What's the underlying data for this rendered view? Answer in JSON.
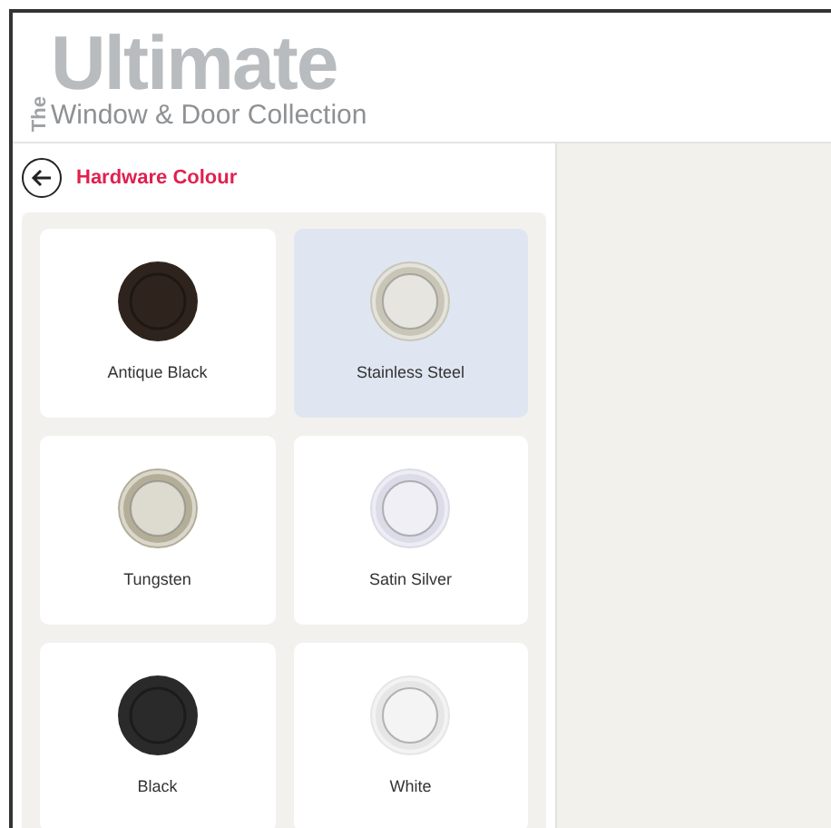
{
  "logo": {
    "prefix": "The",
    "title": "Ultimate",
    "subtitle": "Window & Door Collection"
  },
  "panel": {
    "title": "Hardware Colour"
  },
  "options": [
    {
      "label": "Antique Black",
      "color": "#2e241d",
      "kind": "solid",
      "selected": false
    },
    {
      "label": "Stainless Steel",
      "color": "#c9c6b8",
      "kind": "ring",
      "selected": true
    },
    {
      "label": "Tungsten",
      "color": "#b4ae98",
      "kind": "ring",
      "selected": false
    },
    {
      "label": "Satin Silver",
      "color": "#dcdbe8",
      "kind": "ring",
      "selected": false
    },
    {
      "label": "Black",
      "color": "#2a2a2a",
      "kind": "solid",
      "selected": false
    },
    {
      "label": "White",
      "color": "#e6e6e6",
      "kind": "ring",
      "selected": false
    }
  ]
}
